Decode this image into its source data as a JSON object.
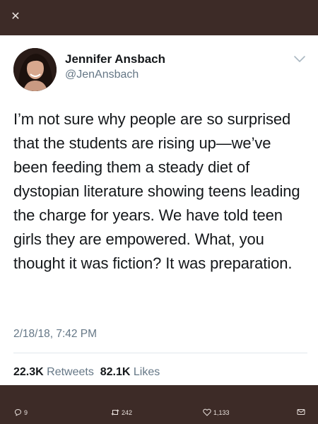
{
  "header": {
    "close_glyph": "✕",
    "background": "#3d2b27"
  },
  "tweet": {
    "author_name": "Jennifer Ansbach",
    "handle": "@JenAnsbach",
    "text": "I’m not sure why people are so surprised that the students are rising up—we’ve been feeding them a steady diet of dystopian literature showing teens leading the charge for years. We have told teen girls they are empowered. What, you thought it was fiction? It was preparation.",
    "timestamp": "2/18/18, 7:42 PM",
    "retweets_count": "22.3K",
    "retweets_label": "Retweets",
    "likes_count": "82.1K",
    "likes_label": "Likes"
  },
  "actions": {
    "replies": "9",
    "retweets": "242",
    "likes": "1,133",
    "icons": [
      "reply-icon",
      "retweet-icon",
      "heart-icon",
      "mail-icon"
    ]
  },
  "colors": {
    "text_primary": "#14171a",
    "text_secondary": "#657786",
    "divider": "#e1e8ed",
    "toolbar_icon": "#e9e1dd"
  }
}
